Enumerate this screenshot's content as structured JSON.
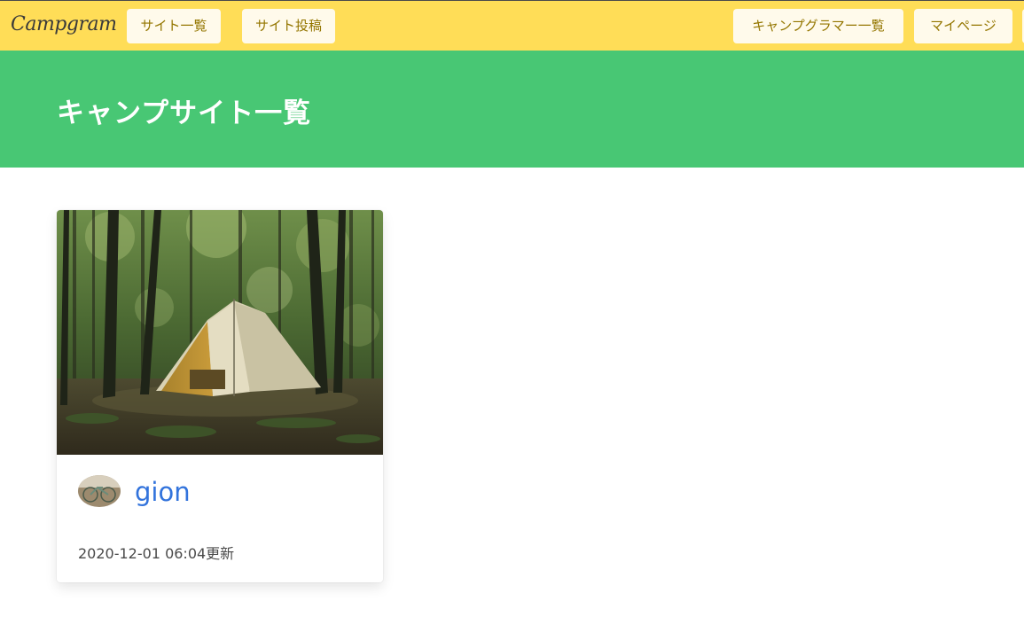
{
  "navbar": {
    "brand": "Campgram",
    "site_list": "サイト一覧",
    "site_post": "サイト投稿",
    "campgramers": "キャンプグラマー一覧",
    "mypage": "マイページ"
  },
  "hero": {
    "title": "キャンプサイト一覧"
  },
  "cards": [
    {
      "image_icon": "camp-tent-forest-photo",
      "avatar_icon": "bicycle-avatar-photo",
      "user": "gion",
      "updated": "2020-12-01 06:04更新"
    }
  ],
  "colors": {
    "navbar_bg": "#ffdd57",
    "nav_button_bg": "#fffaeb",
    "nav_button_text": "#947600",
    "hero_bg": "#48c774",
    "link": "#3273dc"
  }
}
